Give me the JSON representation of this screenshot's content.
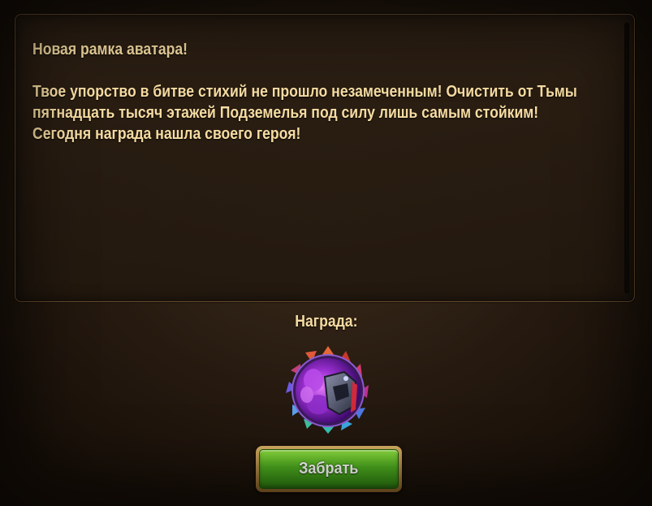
{
  "message": {
    "title": "Новая рамка аватара!",
    "body": "Твое упорство в битве стихий не прошло незамеченным! Очистить от Тьмы пятнадцать тысяч этажей Подземелья под силу лишь самым стойким! Сегодня награда нашла своего героя!"
  },
  "reward": {
    "label": "Награда:",
    "icon": "avatar-frame-icon"
  },
  "actions": {
    "claim_label": "Забрать"
  },
  "colors": {
    "text": "#f6dca2",
    "button_green": "#4fae20",
    "button_border": "#c8a05a"
  }
}
